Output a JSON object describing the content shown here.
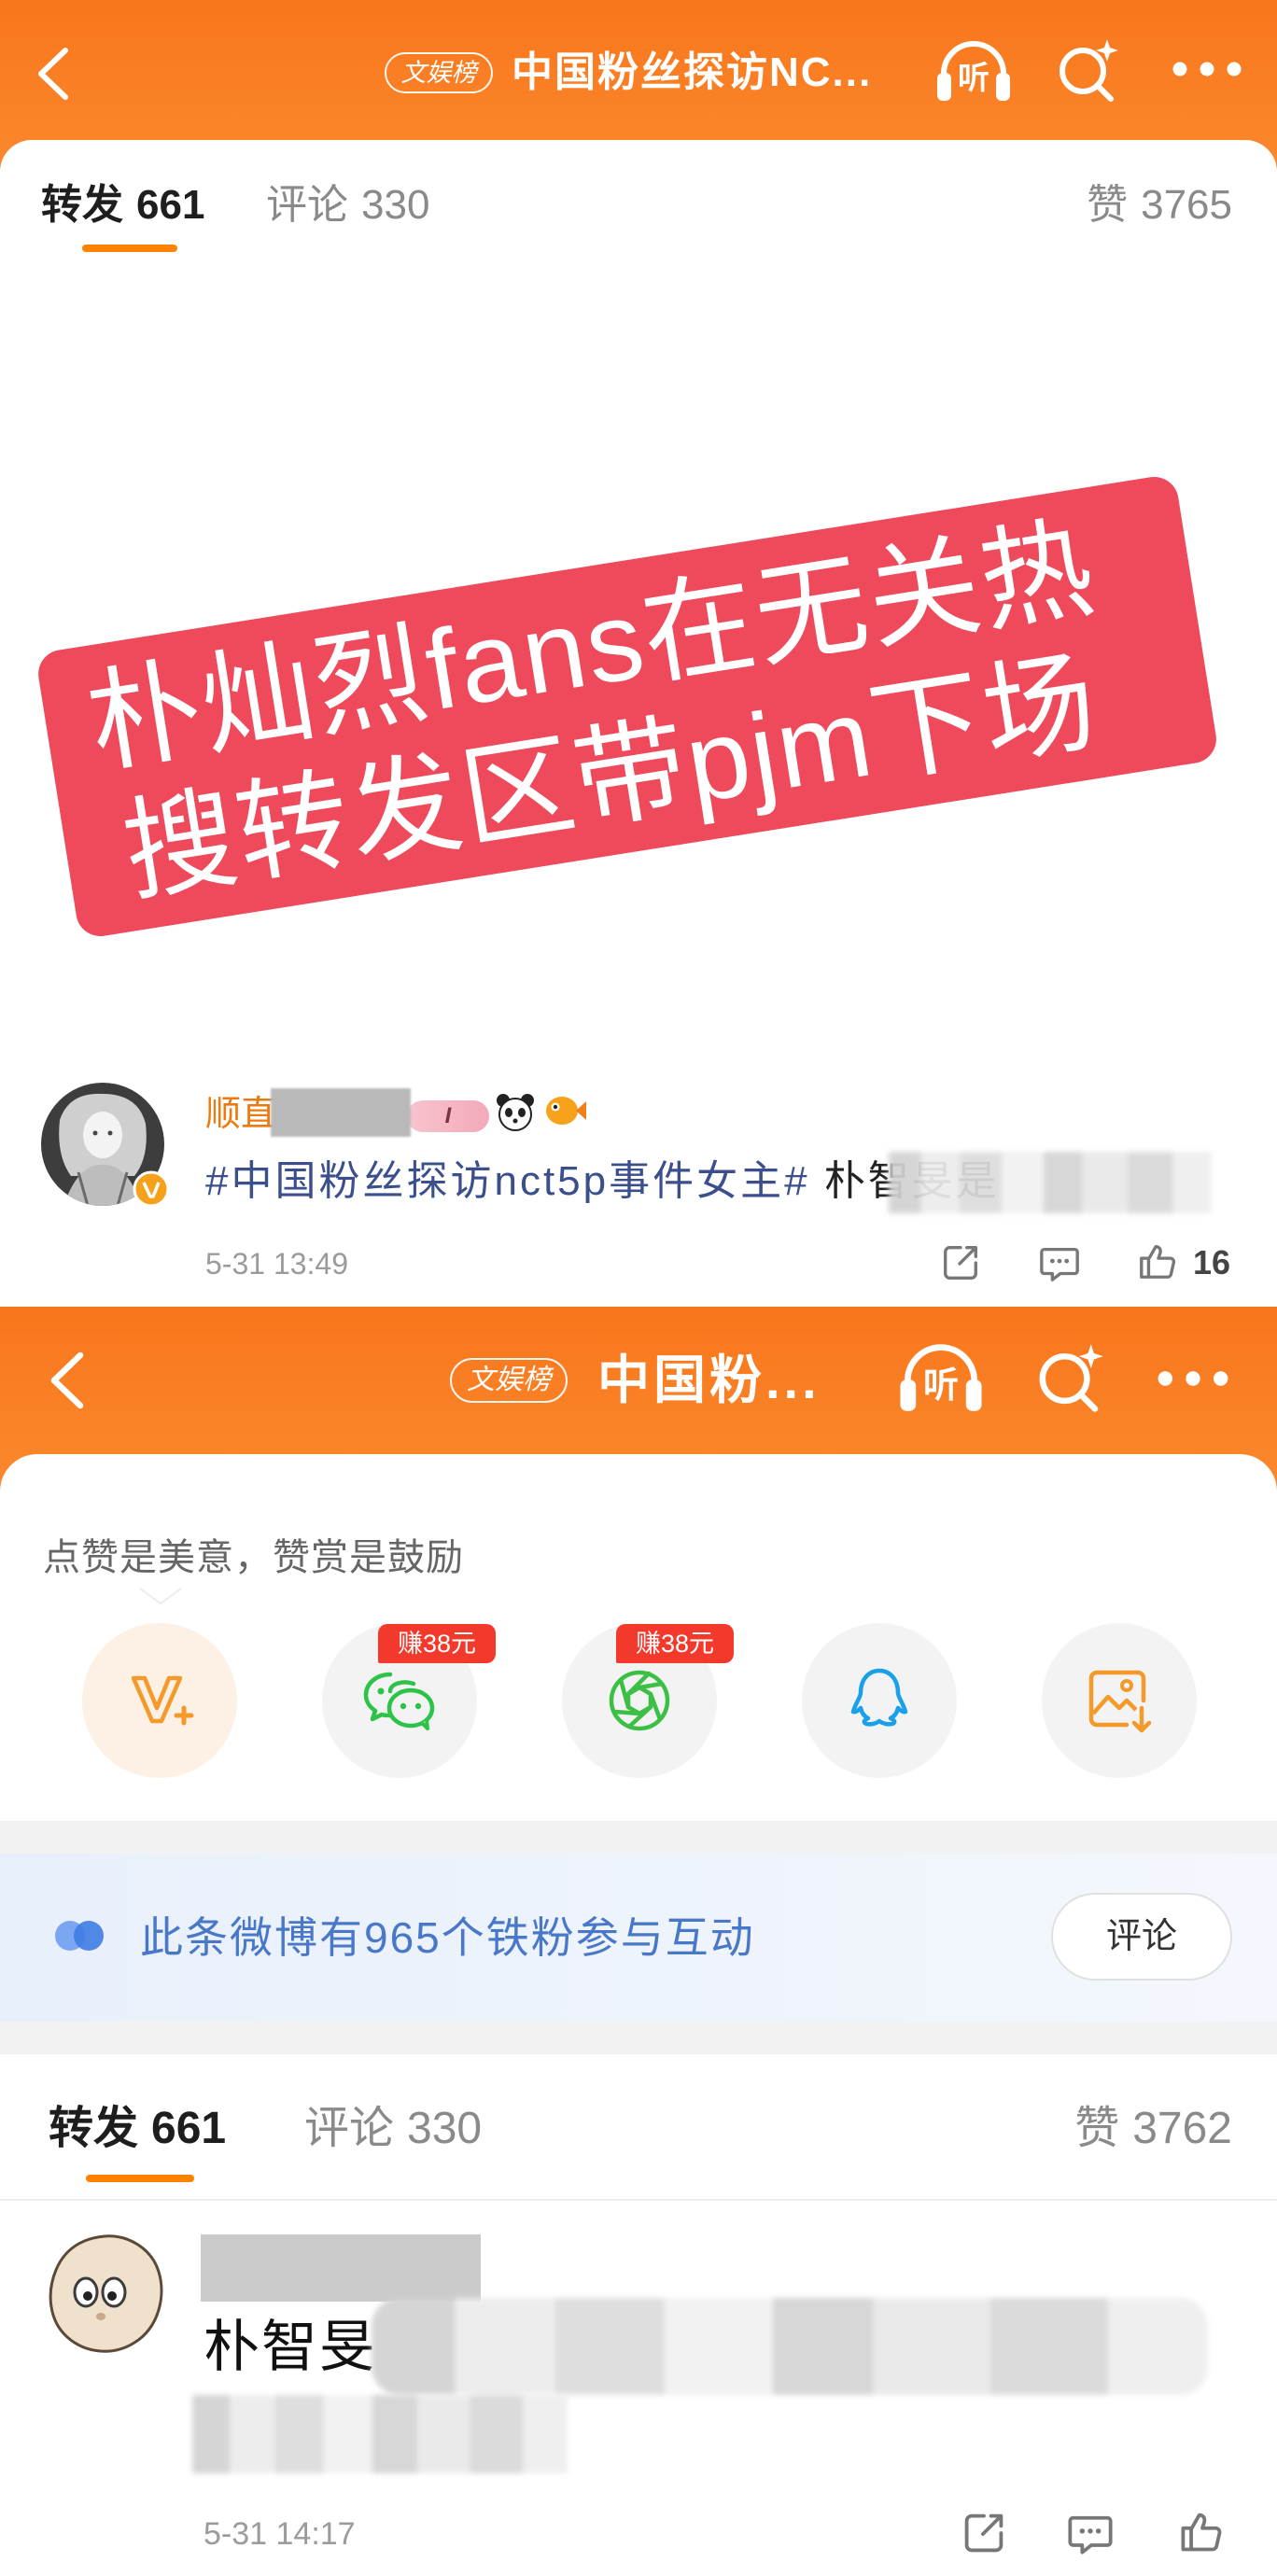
{
  "colors": {
    "brand_orange": "#fb7d22",
    "banner_red": "#ee4a5b",
    "username_orange": "#eb7a10",
    "hashtag_blue": "#3a4f8c",
    "fans_blue": "#4a78c8",
    "earn_badge_red": "#f2392c"
  },
  "top_screen": {
    "header": {
      "badge": "文娱榜",
      "title": "中国粉丝探访NC...",
      "listen_label": "听",
      "icons": [
        "back-icon",
        "listen-icon",
        "search-icon",
        "more-icon"
      ]
    },
    "tabs": [
      {
        "label": "转发",
        "count": "661"
      },
      {
        "label": "评论",
        "count": "330"
      },
      {
        "label": "赞",
        "count": "3765"
      }
    ],
    "banner": {
      "line1": "朴灿烈fans在无关热",
      "line2": "搜转发区带pjm下场"
    },
    "comment": {
      "username": "顺直",
      "badge_text": "I",
      "hashtag": "#中国粉丝探访nct5p事件女主#",
      "text": "朴智旻是",
      "time": "5-31 13:49",
      "like_count": "16",
      "icons": [
        "share-icon",
        "comment-icon",
        "like-icon"
      ]
    }
  },
  "bottom_screen": {
    "header": {
      "badge": "文娱榜",
      "title": "中国粉...",
      "listen_label": "听"
    },
    "reward": {
      "prompt": "点赞是美意，赞赏是鼓励"
    },
    "share_targets": [
      {
        "icon": "vip-plus-icon",
        "badge": ""
      },
      {
        "icon": "wechat-icon",
        "badge": "赚38元"
      },
      {
        "icon": "moments-icon",
        "badge": "赚38元"
      },
      {
        "icon": "qq-icon",
        "badge": ""
      },
      {
        "icon": "save-image-icon",
        "badge": ""
      }
    ],
    "fans": {
      "text": "此条微博有965个铁粉参与互动",
      "button": "评论"
    },
    "tabs": [
      {
        "label": "转发",
        "count": "661"
      },
      {
        "label": "评论",
        "count": "330"
      },
      {
        "label": "赞",
        "count": "3762"
      }
    ],
    "comment": {
      "text": "朴智旻",
      "time": "5-31 14:17"
    }
  }
}
